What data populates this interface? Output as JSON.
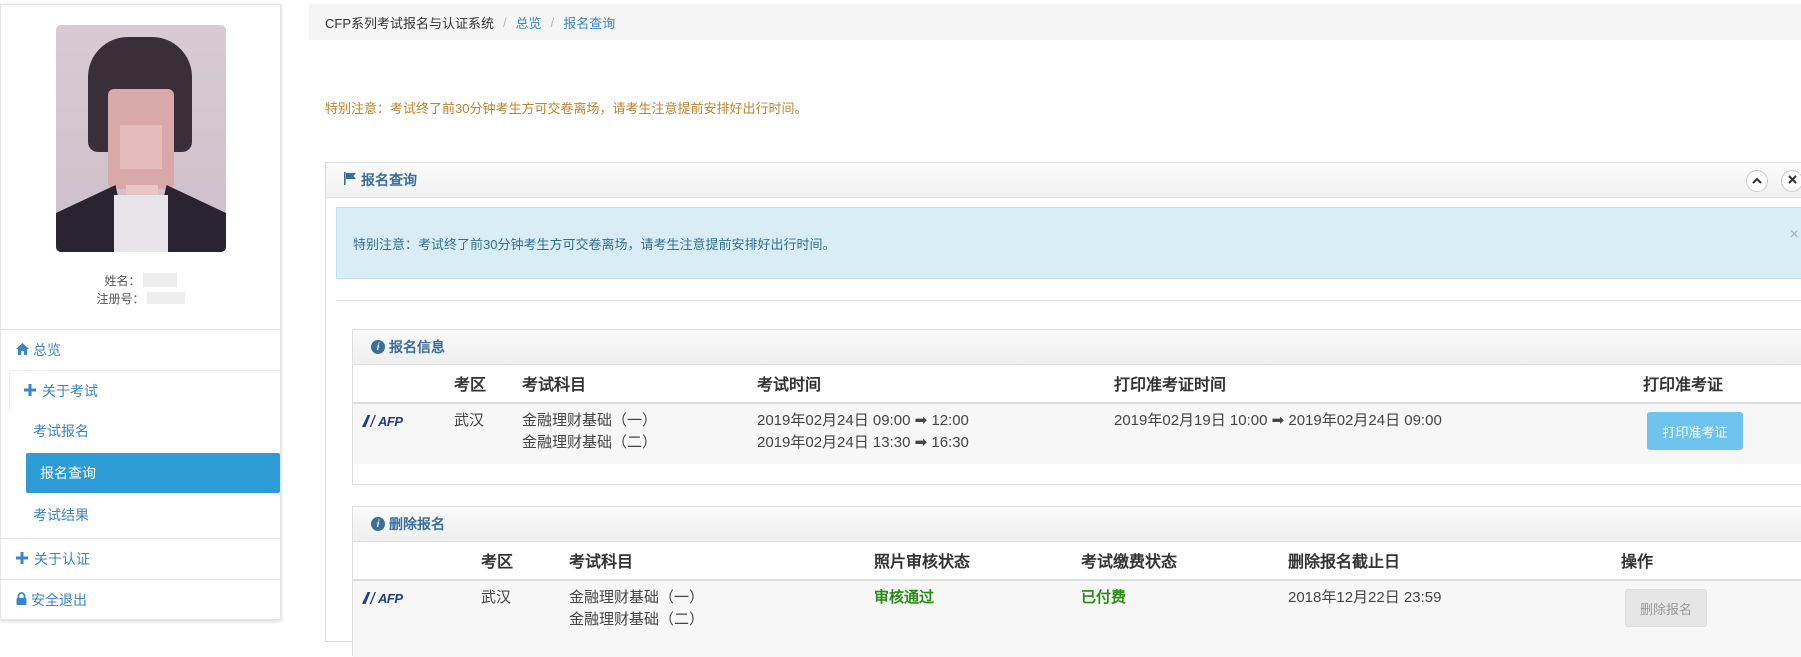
{
  "user": {
    "name_label": "姓名：",
    "reg_label": "注册号："
  },
  "nav": {
    "home": "总览",
    "about_exam": "关于考试",
    "exam_register": "考试报名",
    "register_query": "报名查询",
    "exam_result": "考试结果",
    "about_cert": "关于认证",
    "logout": "安全退出"
  },
  "breadcrumb": [
    "CFP系列考试报名与认证系统",
    "总览",
    "报名查询"
  ],
  "notice": "特别注意：考试终了前30分钟考生方可交卷离场，请考生注意提前安排好出行时间。",
  "panel": {
    "title": "报名查询",
    "alert": "特别注意：考试终了前30分钟考生方可交卷离场，请考生注意提前安排好出行时间。",
    "alert_close": "×"
  },
  "registration_info": {
    "title": "报名信息",
    "headers": [
      "考区",
      "考试科目",
      "考试时间",
      "打印准考证时间",
      "打印准考证"
    ],
    "row": {
      "logo": "AFP",
      "area": "武汉",
      "subjects": [
        "金融理财基础（一）",
        "金融理财基础（二）"
      ],
      "exam_times": [
        "2019年02月24日 09:00 ➡ 12:00",
        "2019年02月24日 13:30 ➡ 16:30"
      ],
      "print_time": "2019年02月19日 10:00 ➡ 2019年02月24日 09:00",
      "print_button": "打印准考证"
    }
  },
  "delete_registration": {
    "title": "删除报名",
    "headers": [
      "考区",
      "考试科目",
      "照片审核状态",
      "考试缴费状态",
      "删除报名截止日",
      "操作"
    ],
    "row": {
      "logo": "AFP",
      "area": "武汉",
      "subjects": [
        "金融理财基础（一）",
        "金融理财基础（二）"
      ],
      "photo_status": "审核通过",
      "pay_status": "已付费",
      "deadline": "2018年12月22日 23:59",
      "delete_button": "删除报名"
    }
  },
  "colors": {
    "link": "#3a87c8",
    "active_nav": "#2c9bd6",
    "notice": "#c0832f",
    "alert_bg": "#d9edf7",
    "success": "#2a8b12",
    "print_button": "#6ec4ee"
  }
}
